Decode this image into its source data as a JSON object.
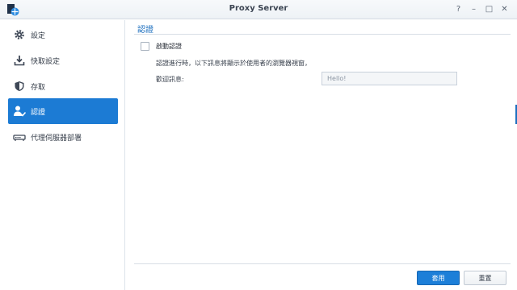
{
  "window": {
    "title": "Proxy Server",
    "controls": [
      "?",
      "–",
      "□",
      "✕"
    ]
  },
  "sidebar": {
    "items": [
      {
        "label": "設定",
        "icon": "gear-icon",
        "active": false
      },
      {
        "label": "快取設定",
        "icon": "download-icon",
        "active": false
      },
      {
        "label": "存取",
        "icon": "shield-icon",
        "active": false
      },
      {
        "label": "認證",
        "icon": "user-check-icon",
        "active": true
      },
      {
        "label": "代理伺服器部署",
        "icon": "router-icon",
        "active": false
      }
    ]
  },
  "main": {
    "section_title": "認證",
    "enable_auth_label": "啟動認證",
    "enable_auth_checked": false,
    "help_text": "認證進行時，以下訊息將顯示於使用者的瀏覽器視窗，",
    "welcome_label": "歡迎訊息:",
    "welcome_value": "Hello!"
  },
  "footer": {
    "apply_label": "套用",
    "reset_label": "重置"
  },
  "colors": {
    "accent": "#1c7bd4",
    "title_text": "#3b4452"
  }
}
